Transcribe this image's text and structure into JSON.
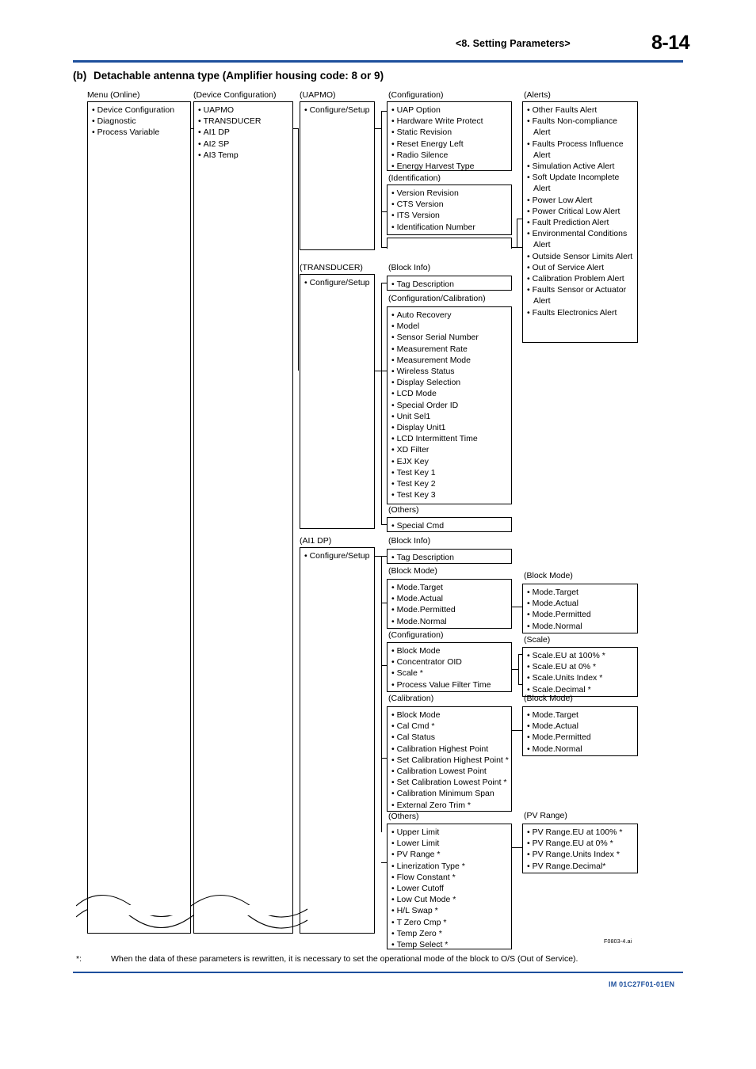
{
  "header": {
    "section": "<8.  Setting Parameters>",
    "page_number": "8-14",
    "rule_color": "#1d4f9c"
  },
  "subtitle": {
    "lead": "(b)",
    "text": "Detachable antenna type (Amplifier housing code: 8 or 9)"
  },
  "diagram": {
    "figure_code": "F0803-4.ai",
    "columns": [
      {
        "caption": "Menu (Online)",
        "items": [
          "Device Configuration",
          "Diagnostic",
          "Process Variable"
        ]
      },
      {
        "caption": "(Device Configuration)",
        "items": [
          "UAPMO",
          "TRANSDUCER",
          "AI1 DP",
          "AI2 SP",
          "AI3 Temp"
        ]
      },
      {
        "caption": "(UAPMO)",
        "items": [
          "Configure/Setup"
        ]
      },
      {
        "caption": "(Configuration)",
        "items": [
          "UAP Option",
          "Hardware Write Protect",
          "Static Revision",
          "Reset Energy Left",
          "Radio Silence",
          "Energy Harvest Type"
        ]
      },
      {
        "caption": "(Identification)",
        "items": [
          "Version Revision",
          "CTS Version",
          "ITS Version",
          "Identification Number"
        ]
      },
      {
        "caption": "(Alerts)",
        "items": [
          "Other Faults Alert",
          "Faults Non-compliance Alert",
          "Faults Process Influence Alert",
          "Simulation Active Alert",
          "Soft Update Incomplete Alert",
          "Power Low Alert",
          "Power Critical Low Alert",
          "Fault Prediction Alert",
          "Environmental Conditions Alert",
          "Outside Sensor Limits Alert",
          "Out of Service Alert",
          "Calibration Problem Alert",
          "Faults Sensor or Actuator Alert",
          "Faults Electronics Alert"
        ]
      },
      {
        "caption": "(TRANSDUCER)",
        "items": [
          "Configure/Setup"
        ]
      },
      {
        "caption": "(Block Info)",
        "items": [
          "Tag Description"
        ]
      },
      {
        "caption": "(Configuration/Calibration)",
        "items": [
          "Auto Recovery",
          "Model",
          "Sensor Serial Number",
          "Measurement Rate",
          "Measurement Mode",
          "Wireless Status",
          "Display Selection",
          "LCD Mode",
          "Special Order ID",
          "Unit Sel1",
          "Display Unit1",
          "LCD Intermittent Time",
          "XD Filter",
          "EJX Key",
          "Test Key 1",
          "Test Key 2",
          "Test Key 3"
        ]
      },
      {
        "caption": "(Others)",
        "items": [
          "Special Cmd"
        ]
      },
      {
        "caption": "(AI1 DP)",
        "items": [
          "Configure/Setup"
        ]
      },
      {
        "caption": "(Block Info)",
        "items": [
          "Tag Description"
        ]
      },
      {
        "caption": "(Block Mode)",
        "items": [
          "Mode.Target",
          "Mode.Actual",
          "Mode.Permitted",
          "Mode.Normal"
        ]
      },
      {
        "caption": "(Configuration)",
        "items": [
          "Block Mode",
          "Concentrator OID",
          "Scale *",
          "Process Value Filter Time"
        ]
      },
      {
        "caption": "(Calibration)",
        "items": [
          "Block Mode",
          "Cal Cmd *",
          "Cal Status",
          "Calibration Highest Point",
          "Set Calibration Highest Point *",
          "Calibration Lowest Point",
          "Set Calibration Lowest Point *",
          "Calibration Minimum Span",
          "External Zero Trim *"
        ]
      },
      {
        "caption": "(Others)",
        "items": [
          "Upper Limit",
          "Lower Limit",
          "PV Range *",
          "Linerization Type *",
          "Flow Constant *",
          "Lower Cutoff",
          "Low Cut Mode *",
          "H/L Swap *",
          "T Zero Cmp *",
          "Temp Zero *",
          "Temp Select *"
        ]
      },
      {
        "caption": "(Block Mode)",
        "items": [
          "Mode.Target",
          "Mode.Actual",
          "Mode.Permitted",
          "Mode.Normal"
        ]
      },
      {
        "caption": "(Scale)",
        "items": [
          "Scale.EU at 100% *",
          "Scale.EU at 0% *",
          "Scale.Units Index *",
          "Scale.Decimal *"
        ]
      },
      {
        "caption": "(Block Mode)",
        "items": [
          "Mode.Target",
          "Mode.Actual",
          "Mode.Permitted",
          "Mode.Normal"
        ]
      },
      {
        "caption": "(PV Range)",
        "items": [
          "PV Range.EU at 100% *",
          "PV Range.EU at 0% *",
          "PV Range.Units Index *",
          "PV Range.Decimal*"
        ]
      }
    ]
  },
  "footnote": {
    "marker": "*:",
    "text": "When the data of these parameters is rewritten, it is necessary to set the operational mode of the block to O/S (Out of Service)."
  },
  "footer": {
    "document_code": "IM 01C27F01-01EN"
  }
}
